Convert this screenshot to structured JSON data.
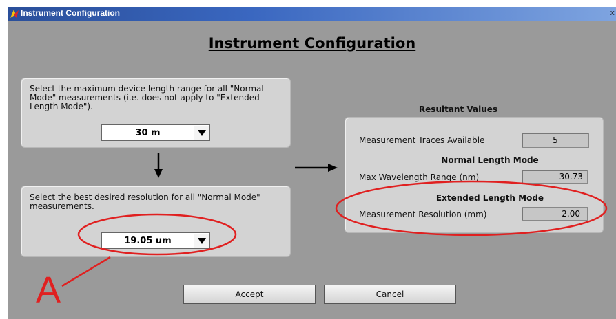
{
  "window": {
    "title": "Instrument Configuration",
    "close_glyph": "x",
    "heading": "Instrument Configuration"
  },
  "length_panel": {
    "description": "Select the maximum device length range for all \"Normal Mode\" measurements (i.e. does not apply to \"Extended Length Mode\").",
    "selected_value": "30 m"
  },
  "resolution_panel": {
    "description": "Select the best desired resolution for all \"Normal Mode\" measurements.",
    "selected_value": "19.05 um"
  },
  "resultant_values": {
    "title": "Resultant Values",
    "traces_label": "Measurement Traces Available",
    "traces_value": "5",
    "normal_mode_heading": "Normal Length Mode",
    "wavelength_label": "Max Wavelength Range (nm)",
    "wavelength_value": "30.73",
    "extended_mode_heading": "Extended Length Mode",
    "resolution_label": "Measurement Resolution (mm)",
    "resolution_value": "2.00"
  },
  "buttons": {
    "accept": "Accept",
    "cancel": "Cancel"
  },
  "annotation": {
    "letter": "A",
    "color": "#e02020"
  },
  "icons": [
    "app-icon",
    "close-icon",
    "dropdown-arrow-icon",
    "arrow-down-icon",
    "arrow-right-icon"
  ]
}
